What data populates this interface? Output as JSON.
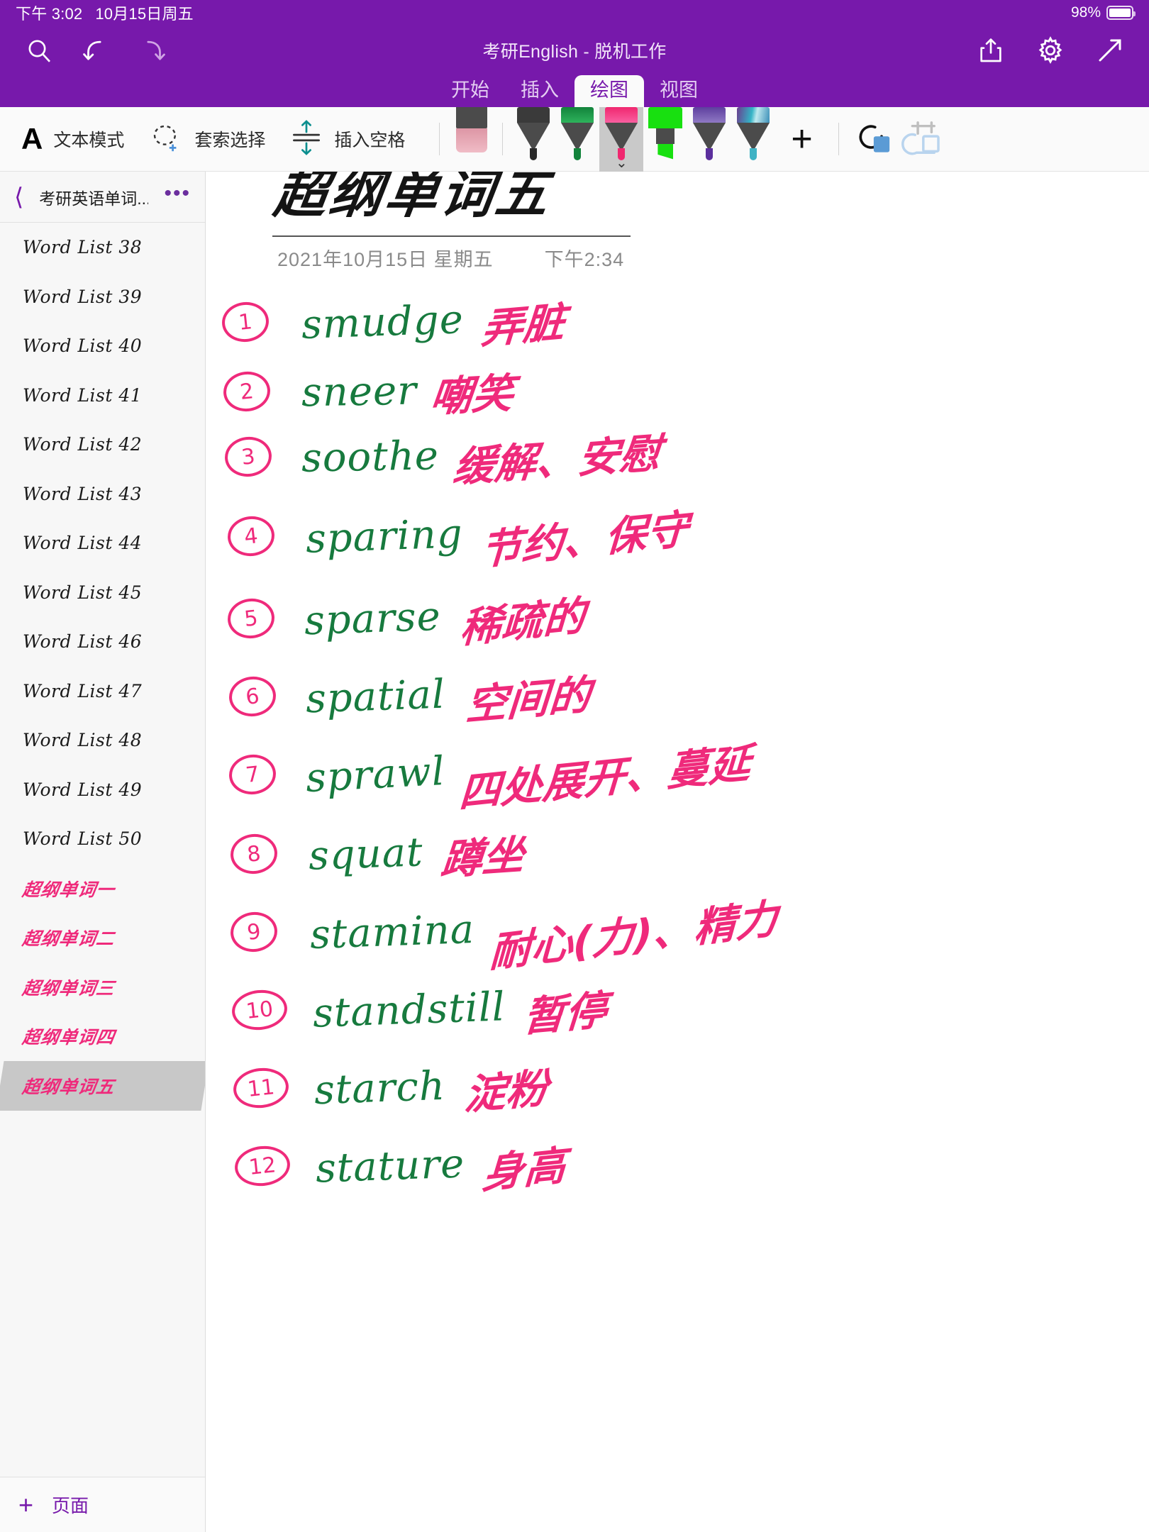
{
  "status_bar": {
    "time": "下午 3:02",
    "date": "10月15日周五",
    "battery_percent": "98%",
    "battery_icon": "battery-icon"
  },
  "header": {
    "title": "考研English - 脱机工作",
    "search_icon": "search-icon",
    "undo_icon": "undo-icon",
    "redo_icon": "redo-icon",
    "share_icon": "share-icon",
    "settings_icon": "gear-icon",
    "expand_icon": "expand-icon",
    "tabs": [
      {
        "label": "开始",
        "active": false
      },
      {
        "label": "插入",
        "active": false
      },
      {
        "label": "绘图",
        "active": true
      },
      {
        "label": "视图",
        "active": false
      }
    ]
  },
  "toolbar": {
    "text_mode_glyph": "A",
    "text_mode_label": "文本模式",
    "lasso_icon": "lasso-select-icon",
    "lasso_label": "套索选择",
    "insert_space_icon": "insert-space-icon",
    "insert_space_label": "插入空格",
    "add_pen_label": "+",
    "undo_ink_icon": "ink-to-shape-icon",
    "ink_to_text_icon": "ink-to-text-icon",
    "pen_dropdown_icon": "chevron-down-icon",
    "pens": [
      {
        "name": "eraser",
        "type": "eraser",
        "color": "#e0a6b2",
        "selected": false
      },
      {
        "name": "pen-black",
        "type": "pen",
        "color": "#3a3a3a",
        "selected": false
      },
      {
        "name": "pen-green-dark",
        "type": "pen",
        "color": "#17913f",
        "selected": false
      },
      {
        "name": "pen-pink",
        "type": "pen",
        "color": "#f0276f",
        "selected": true
      },
      {
        "name": "highlighter-green",
        "type": "highlighter",
        "color": "#18e010",
        "selected": false
      },
      {
        "name": "pen-purple",
        "type": "pen",
        "color": "#6b4fad",
        "selected": false
      },
      {
        "name": "pen-galaxy",
        "type": "pen",
        "color": "#5fc9d8",
        "selected": false
      }
    ]
  },
  "sidebar": {
    "back_icon": "chevron-left-icon",
    "notebook_name": "考研英语单词...",
    "more_icon": "more-options-icon",
    "items": [
      {
        "label": "Word List 38",
        "cn": false,
        "selected": false
      },
      {
        "label": "Word List 39",
        "cn": false,
        "selected": false
      },
      {
        "label": "Word List 40",
        "cn": false,
        "selected": false
      },
      {
        "label": "Word List 41",
        "cn": false,
        "selected": false
      },
      {
        "label": "Word List 42",
        "cn": false,
        "selected": false
      },
      {
        "label": "Word List 43",
        "cn": false,
        "selected": false
      },
      {
        "label": "Word List 44",
        "cn": false,
        "selected": false
      },
      {
        "label": "Word List 45",
        "cn": false,
        "selected": false
      },
      {
        "label": "Word List 46",
        "cn": false,
        "selected": false
      },
      {
        "label": "Word List 47",
        "cn": false,
        "selected": false
      },
      {
        "label": "Word List 48",
        "cn": false,
        "selected": false
      },
      {
        "label": "Word List 49",
        "cn": false,
        "selected": false
      },
      {
        "label": "Word List 50",
        "cn": false,
        "selected": false
      },
      {
        "label": "超纲单词一",
        "cn": true,
        "selected": false
      },
      {
        "label": "超纲单词二",
        "cn": true,
        "selected": false
      },
      {
        "label": "超纲单词三",
        "cn": true,
        "selected": false
      },
      {
        "label": "超纲单词四",
        "cn": true,
        "selected": false
      },
      {
        "label": "超纲单词五",
        "cn": true,
        "selected": true
      }
    ],
    "add_page_icon": "plus-icon",
    "add_page_label": "页面"
  },
  "note": {
    "title": "超纲单词五",
    "date": "2021年10月15日 星期五",
    "time": "下午2:34",
    "entries": [
      {
        "num": "1",
        "en": "smudge",
        "cn": "弄脏"
      },
      {
        "num": "2",
        "en": "sneer",
        "cn": "嘲笑"
      },
      {
        "num": "3",
        "en": "soothe",
        "cn": "缓解、安慰"
      },
      {
        "num": "4",
        "en": "sparing",
        "cn": "节约、保守"
      },
      {
        "num": "5",
        "en": "sparse",
        "cn": "稀疏的"
      },
      {
        "num": "6",
        "en": "spatial",
        "cn": "空间的"
      },
      {
        "num": "7",
        "en": "sprawl",
        "cn": "四处展开、蔓延"
      },
      {
        "num": "8",
        "en": "squat",
        "cn": "蹲坐"
      },
      {
        "num": "9",
        "en": "stamina",
        "cn": "耐心(力)、精力"
      },
      {
        "num": "10",
        "en": "standstill",
        "cn": "暂停"
      },
      {
        "num": "11",
        "en": "starch",
        "cn": "淀粉"
      },
      {
        "num": "12",
        "en": "stature",
        "cn": "身高"
      }
    ]
  }
}
